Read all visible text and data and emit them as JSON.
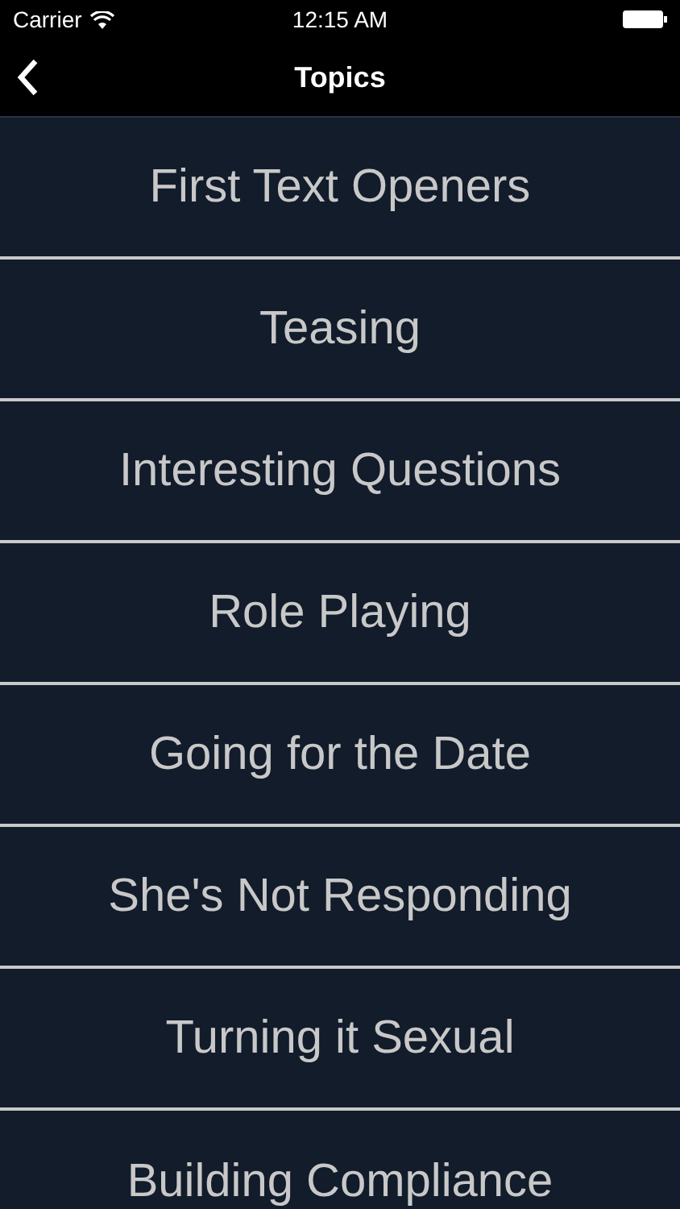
{
  "status_bar": {
    "carrier": "Carrier",
    "time": "12:15 AM"
  },
  "nav_bar": {
    "title": "Topics"
  },
  "topics": [
    {
      "label": "First Text Openers"
    },
    {
      "label": "Teasing"
    },
    {
      "label": "Interesting Questions"
    },
    {
      "label": "Role Playing"
    },
    {
      "label": "Going for the Date"
    },
    {
      "label": "She's Not Responding"
    },
    {
      "label": "Turning it Sexual"
    },
    {
      "label": "Building Compliance"
    }
  ]
}
